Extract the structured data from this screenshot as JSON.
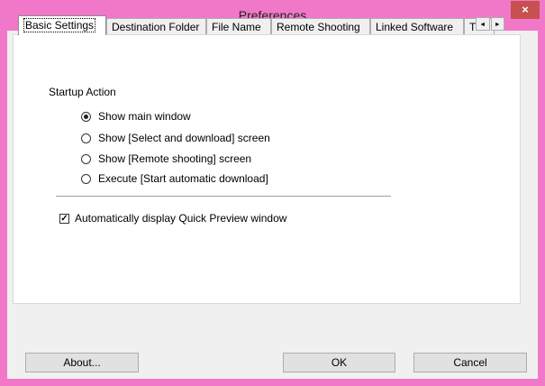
{
  "window": {
    "title": "Preferences",
    "close_label": "×",
    "accent_color": "#f178c8"
  },
  "tabs": [
    {
      "label": "Basic Settings",
      "active": true
    },
    {
      "label": "Destination Folder",
      "active": false
    },
    {
      "label": "File Name",
      "active": false
    },
    {
      "label": "Remote Shooting",
      "active": false
    },
    {
      "label": "Linked Software",
      "active": false
    },
    {
      "label": "Tim",
      "active": false
    }
  ],
  "tab_scroll": {
    "left": "◄",
    "right": "►"
  },
  "startup": {
    "label": "Startup Action",
    "options": [
      {
        "label": "Show main window",
        "checked": true
      },
      {
        "label": "Show [Select and download] screen",
        "checked": false
      },
      {
        "label": "Show [Remote shooting] screen",
        "checked": false
      },
      {
        "label": "Execute [Start automatic download]",
        "checked": false
      }
    ]
  },
  "quick_preview": {
    "label": "Automatically display Quick Preview window",
    "checked": true,
    "mark": "✓"
  },
  "buttons": {
    "about": "About...",
    "ok": "OK",
    "cancel": "Cancel"
  }
}
